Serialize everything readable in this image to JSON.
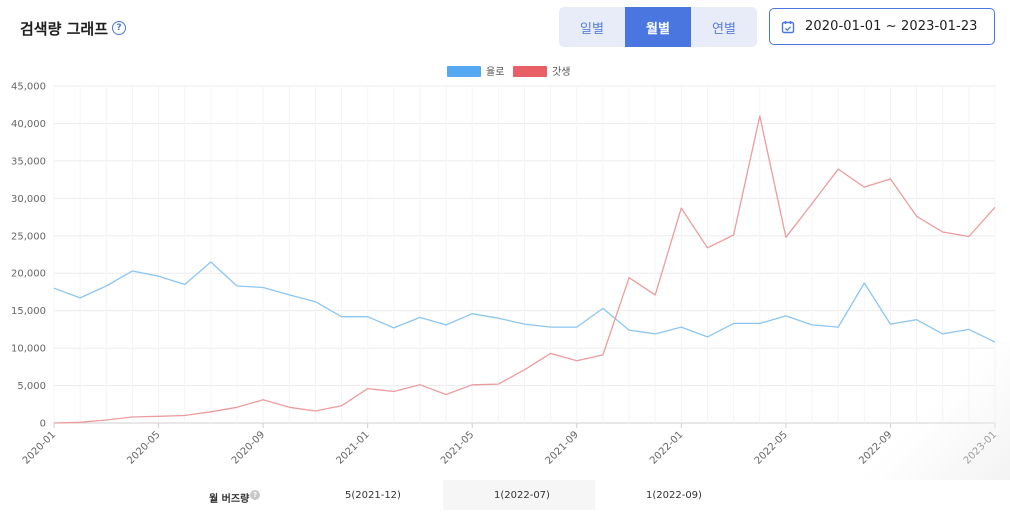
{
  "header": {
    "title": "검색량 그래프",
    "help_icon": "question-circle-icon",
    "tabs": [
      {
        "label": "일별",
        "active": false
      },
      {
        "label": "월별",
        "active": true
      },
      {
        "label": "연별",
        "active": false
      }
    ],
    "date_range": "2020-01-01 ~ 2023-01-23",
    "date_icon": "calendar-icon"
  },
  "colors": {
    "accent": "#4a76e0",
    "series_blue": "#8cc6f0",
    "series_red": "#ec9c9e",
    "legend_blue": "#54a9f2",
    "legend_red": "#e86065"
  },
  "chart_data": {
    "type": "line",
    "legend_position": "top-center",
    "grid": true,
    "ylim": [
      0,
      45000
    ],
    "y_ticks": [
      "0",
      "5,000",
      "10,000",
      "15,000",
      "20,000",
      "25,000",
      "30,000",
      "35,000",
      "40,000",
      "45,000"
    ],
    "x_ticks": [
      "2020-01",
      "2020-05",
      "2020-09",
      "2021-01",
      "2021-05",
      "2021-09",
      "2022-01",
      "2022-05",
      "2022-09",
      "2023-01"
    ],
    "x": [
      "2020-01",
      "2020-02",
      "2020-03",
      "2020-04",
      "2020-05",
      "2020-06",
      "2020-07",
      "2020-08",
      "2020-09",
      "2020-10",
      "2020-11",
      "2020-12",
      "2021-01",
      "2021-02",
      "2021-03",
      "2021-04",
      "2021-05",
      "2021-06",
      "2021-07",
      "2021-08",
      "2021-09",
      "2021-10",
      "2021-11",
      "2021-12",
      "2022-01",
      "2022-02",
      "2022-03",
      "2022-04",
      "2022-05",
      "2022-06",
      "2022-07",
      "2022-08",
      "2022-09",
      "2022-10",
      "2022-11",
      "2022-12",
      "2023-01"
    ],
    "series": [
      {
        "name": "율로",
        "color": "#8cc6f0",
        "values": [
          18000,
          16700,
          18300,
          20300,
          19600,
          18500,
          21500,
          18300,
          18100,
          17100,
          16200,
          14200,
          14200,
          12700,
          14100,
          13100,
          14600,
          14000,
          13200,
          12800,
          12800,
          15300,
          12400,
          11900,
          12800,
          11500,
          13300,
          13300,
          14300,
          13100,
          12800,
          18700,
          13200,
          13800,
          11900,
          12500,
          10800
        ]
      },
      {
        "name": "갓생",
        "color": "#ec9c9e",
        "values": [
          0,
          100,
          400,
          800,
          900,
          1000,
          1500,
          2100,
          3100,
          2100,
          1600,
          2300,
          4600,
          4200,
          5100,
          3800,
          5100,
          5200,
          7100,
          9300,
          8300,
          9100,
          19400,
          17100,
          28700,
          23400,
          25100,
          41000,
          24800,
          29300,
          33900,
          31500,
          32600,
          27600,
          25500,
          24900,
          28800
        ]
      }
    ]
  },
  "footer": {
    "label": "월 버즈량",
    "help_icon": "question-circle-icon",
    "values": [
      "5(2021-12)",
      "1(2022-07)",
      "1(2022-09)"
    ]
  }
}
